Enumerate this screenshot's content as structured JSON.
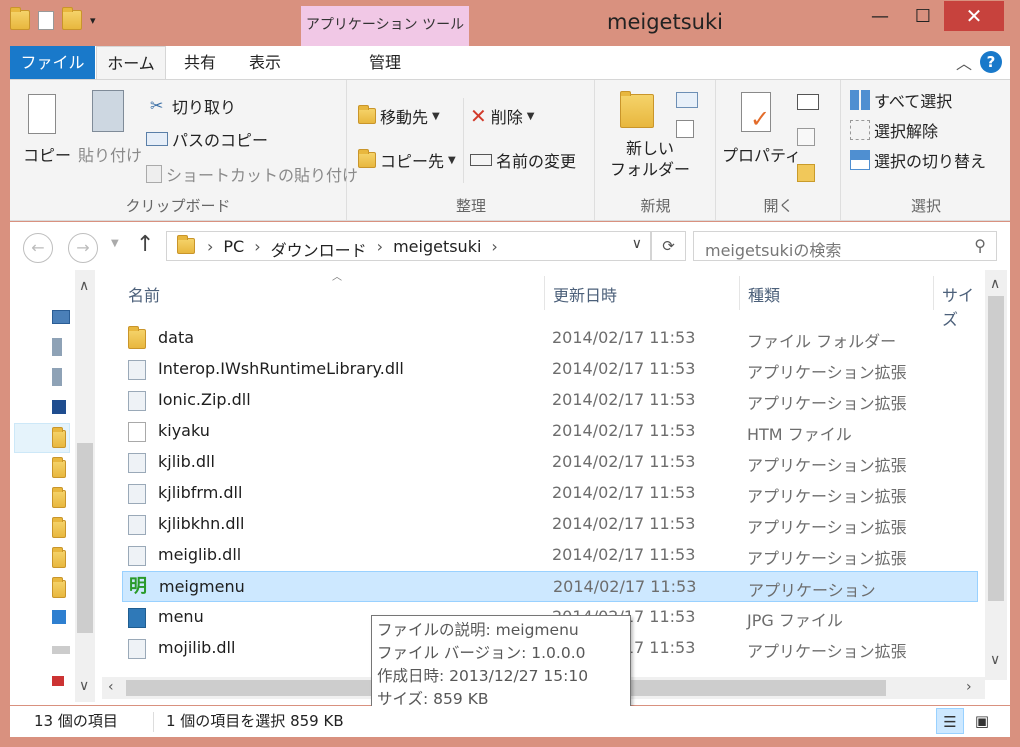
{
  "window": {
    "title": "meigetsuki",
    "context_tab": "アプリケーション ツール",
    "minimize": "—",
    "maximize": "☐",
    "close": "✕"
  },
  "tabs": {
    "file": "ファイル",
    "home": "ホーム",
    "share": "共有",
    "view": "表示",
    "manage": "管理"
  },
  "ribbon": {
    "clipboard": {
      "copy": "コピー",
      "paste": "貼り付け",
      "cut": "切り取り",
      "copy_path": "パスのコピー",
      "paste_shortcut": "ショートカットの貼り付け",
      "label": "クリップボード"
    },
    "organize": {
      "move_to": "移動先",
      "delete": "削除",
      "copy_to": "コピー先",
      "rename": "名前の変更",
      "label": "整理"
    },
    "new": {
      "new_folder_1": "新しい",
      "new_folder_2": "フォルダー",
      "label": "新規"
    },
    "open": {
      "properties": "プロパティ",
      "label": "開く"
    },
    "select": {
      "select_all": "すべて選択",
      "select_none": "選択解除",
      "invert": "選択の切り替え",
      "label": "選択"
    }
  },
  "address": {
    "crumbs": [
      "PC",
      "ダウンロード",
      "meigetsuki"
    ],
    "search_placeholder": "meigetsukiの検索"
  },
  "columns": {
    "name": "名前",
    "date": "更新日時",
    "type": "種類",
    "size": "サイズ"
  },
  "files": [
    {
      "name": "data",
      "date": "2014/02/17 11:53",
      "type": "ファイル フォルダー",
      "icon": "folder-icon"
    },
    {
      "name": "Interop.IWshRuntimeLibrary.dll",
      "date": "2014/02/17 11:53",
      "type": "アプリケーション拡張",
      "icon": "dll-icon"
    },
    {
      "name": "Ionic.Zip.dll",
      "date": "2014/02/17 11:53",
      "type": "アプリケーション拡張",
      "icon": "dll-icon"
    },
    {
      "name": "kiyaku",
      "date": "2014/02/17 11:53",
      "type": "HTM ファイル",
      "icon": "text-file-icon"
    },
    {
      "name": "kjlib.dll",
      "date": "2014/02/17 11:53",
      "type": "アプリケーション拡張",
      "icon": "dll-icon"
    },
    {
      "name": "kjlibfrm.dll",
      "date": "2014/02/17 11:53",
      "type": "アプリケーション拡張",
      "icon": "dll-icon"
    },
    {
      "name": "kjlibkhn.dll",
      "date": "2014/02/17 11:53",
      "type": "アプリケーション拡張",
      "icon": "dll-icon"
    },
    {
      "name": "meiglib.dll",
      "date": "2014/02/17 11:53",
      "type": "アプリケーション拡張",
      "icon": "dll-icon"
    },
    {
      "name": "meigmenu",
      "date": "2014/02/17 11:53",
      "type": "アプリケーション",
      "icon": "app-icon",
      "selected": true
    },
    {
      "name": "menu",
      "date": "2014/02/17 11:53",
      "type": "JPG ファイル",
      "icon": "image-icon"
    },
    {
      "name": "mojilib.dll",
      "date": "2014/02/17 11:53",
      "type": "アプリケーション拡張",
      "icon": "dll-icon"
    }
  ],
  "tooltip": {
    "line1": "ファイルの説明: meigmenu",
    "line2": "ファイル バージョン: 1.0.0.0",
    "line3": "作成日時: 2013/12/27 15:10",
    "line4": "サイズ: 859 KB"
  },
  "status": {
    "count": "13 個の項目",
    "selection": "1 個の項目を選択  859 KB"
  },
  "colors": {
    "accent": "#1979ca",
    "frame": "#d9917f",
    "close": "#c7423d",
    "selection": "#cde8ff"
  }
}
